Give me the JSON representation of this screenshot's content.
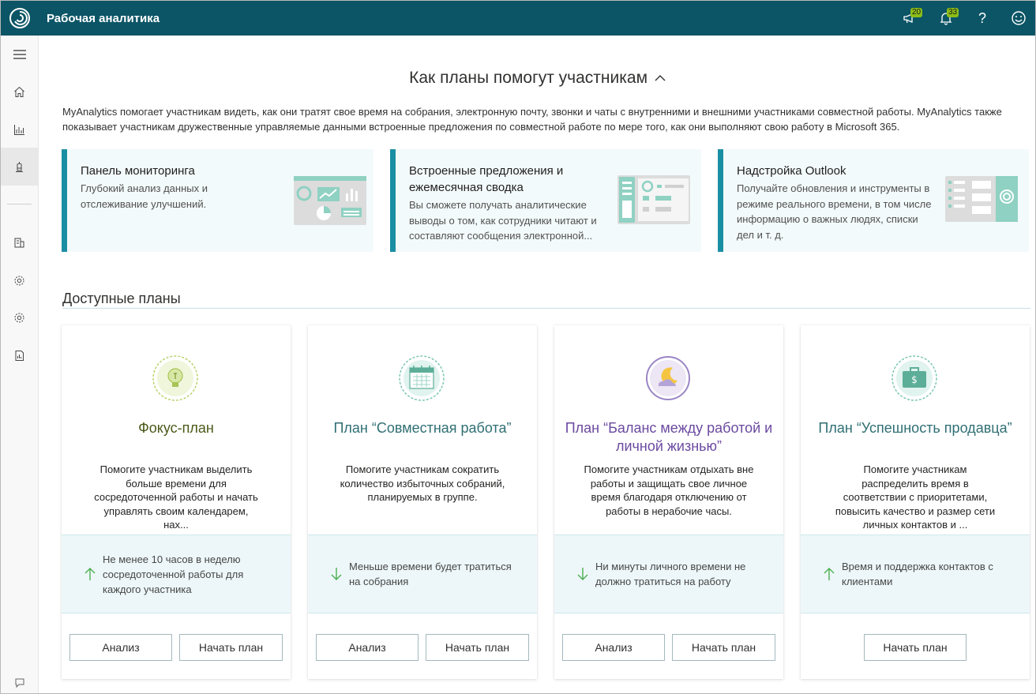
{
  "header": {
    "app_title": "Рабочая аналитика",
    "announcements_count": "20",
    "notifications_count": "33",
    "help_glyph": "?"
  },
  "sidebar": {
    "items": [
      "hamburger-menu-icon",
      "home-icon",
      "chart-icon",
      "lamp-icon",
      "report-users-icon",
      "settings-icon",
      "settings-alt-icon",
      "document-chart-icon",
      "feedback-icon"
    ]
  },
  "intro": {
    "title": "Как планы помогут участникам",
    "text": "MyAnalytics помогает участникам видеть, как они тратят свое время на собрания, электронную почту, звонки и чаты с внутренними и внешними участниками совместной работы. MyAnalytics также показывает участникам дружественные управляемые данными встроенные предложения по совместной работе по мере того, как они выполняют свою работу в Microsoft 365."
  },
  "features": [
    {
      "title": "Панель мониторинга",
      "desc": "Глубокий анализ данных и отслеживание улучшений."
    },
    {
      "title": "Встроенные предложения и ежемесячная сводка",
      "desc": "Вы сможете получать аналитические выводы о том, как сотрудники читают и составляют сообщения электронной..."
    },
    {
      "title": "Надстройка Outlook",
      "desc": "Получайте обновления и инструменты в режиме реального времени, в том числе информацию о важных людях, списки дел и т. д."
    }
  ],
  "plans_section": {
    "title": "Доступные планы"
  },
  "plans": [
    {
      "title": "Фокус-план",
      "title_color": "#4a5a1a",
      "desc": "Помогите участникам выделить больше времени для сосредоточенной работы и начать управлять своим календарем, нах...",
      "metric": "Не менее 10 часов в неделю сосредоточенной работы для каждого участника",
      "metric_direction": "up",
      "buttons": [
        "Анализ",
        "Начать план"
      ]
    },
    {
      "title": "План “Совместная работа”",
      "title_color": "#2f6f73",
      "desc": "Помогите участникам сократить количество избыточных собраний, планируемых в группе.",
      "metric": "Меньше времени будет тратиться на собрания",
      "metric_direction": "down",
      "buttons": [
        "Анализ",
        "Начать план"
      ]
    },
    {
      "title": "План “Баланс между работой и личной жизнью”",
      "title_color": "#6b4aa0",
      "desc": "Помогите участникам отдыхать вне работы и защищать свое личное время благодаря отключению от работы в нерабочие часы.",
      "metric": "Ни минуты личного времени не должно тратиться на работу",
      "metric_direction": "down",
      "buttons": [
        "Анализ",
        "Начать план"
      ]
    },
    {
      "title": "План “Успешность продавца”",
      "title_color": "#2f6f73",
      "desc": "Помогите участникам распределить время в соответствии с приоритетами, повысить качество и размер сети личных контактов и ...",
      "metric": "Время и поддержка контактов с клиентами",
      "metric_direction": "up",
      "buttons": [
        "Начать план"
      ]
    }
  ]
}
